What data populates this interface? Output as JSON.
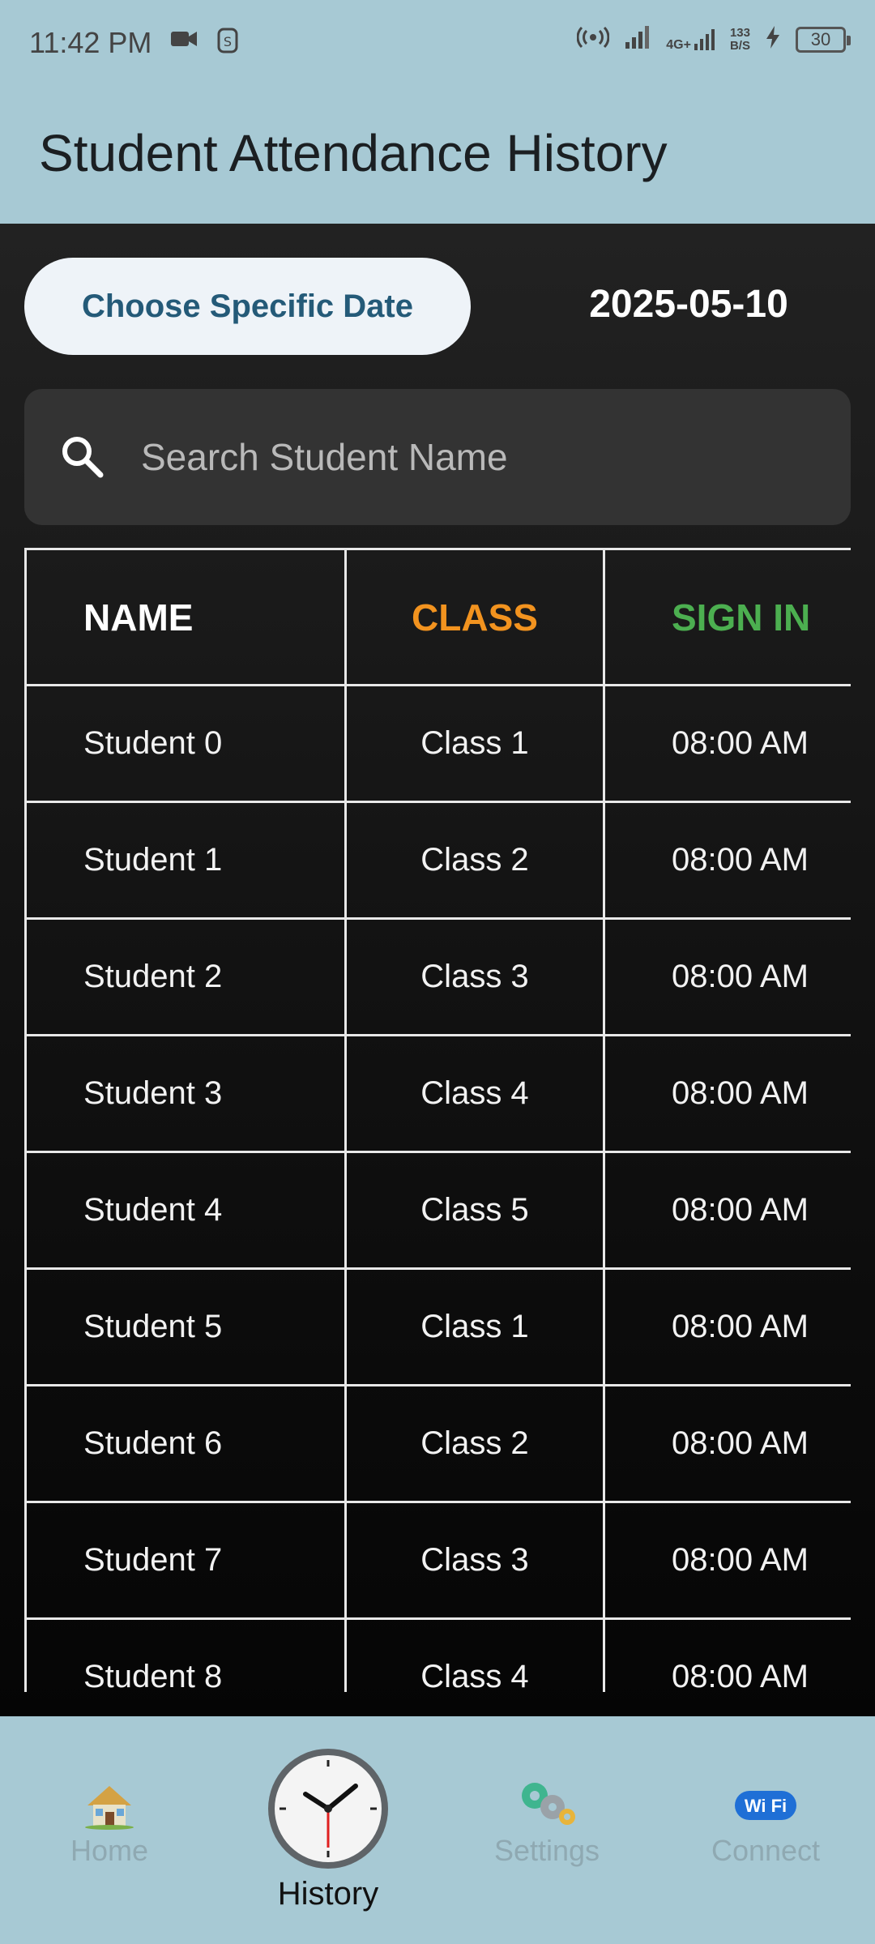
{
  "status_bar": {
    "time": "11:42 PM",
    "network_speed_top": "133",
    "network_speed_bottom": "B/S",
    "network_type": "4G+",
    "battery": "30"
  },
  "app_bar": {
    "title": "Student Attendance History"
  },
  "controls": {
    "date_button_label": "Choose Specific Date",
    "selected_date": "2025-05-10"
  },
  "search": {
    "placeholder": "Search Student Name",
    "value": ""
  },
  "table": {
    "headers": [
      "NAME",
      "CLASS",
      "SIGN IN"
    ],
    "header_colors": {
      "name": "#ffffff",
      "class": "#f2931f",
      "sign_in": "#4caf50"
    },
    "rows": [
      {
        "name": "Student 0",
        "class": "Class 1",
        "sign_in": "08:00 AM"
      },
      {
        "name": "Student 1",
        "class": "Class 2",
        "sign_in": "08:00 AM"
      },
      {
        "name": "Student 2",
        "class": "Class 3",
        "sign_in": "08:00 AM"
      },
      {
        "name": "Student 3",
        "class": "Class 4",
        "sign_in": "08:00 AM"
      },
      {
        "name": "Student 4",
        "class": "Class 5",
        "sign_in": "08:00 AM"
      },
      {
        "name": "Student 5",
        "class": "Class 1",
        "sign_in": "08:00 AM"
      },
      {
        "name": "Student 6",
        "class": "Class 2",
        "sign_in": "08:00 AM"
      },
      {
        "name": "Student 7",
        "class": "Class 3",
        "sign_in": "08:00 AM"
      },
      {
        "name": "Student 8",
        "class": "Class 4",
        "sign_in": "08:00 AM"
      }
    ]
  },
  "bottom_nav": {
    "items": [
      {
        "label": "Home",
        "icon": "house-icon",
        "active": false
      },
      {
        "label": "History",
        "icon": "clock-icon",
        "active": true
      },
      {
        "label": "Settings",
        "icon": "gears-icon",
        "active": false
      },
      {
        "label": "Connect",
        "icon": "wifi-icon",
        "active": false
      }
    ]
  },
  "colors": {
    "app_bar_bg": "#a7c9d4",
    "accent_button_text": "#245a78"
  }
}
